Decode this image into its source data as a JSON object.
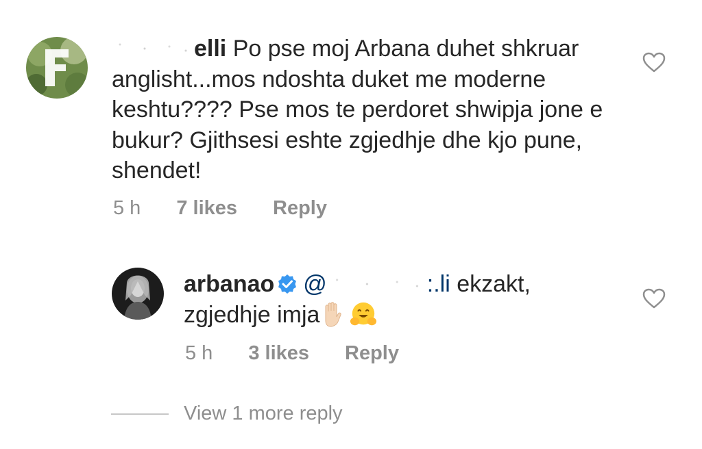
{
  "comments": [
    {
      "username_visible": "elli",
      "text": "Po pse moj Arbana duhet shkruar anglisht...mos ndoshta duket me moderne keshtu???? Pse mos te perdoret shwipja jone e bukur? Gjithsesi eshte zgjedhje dhe kjo pune, shendet!",
      "time": "5 h",
      "likes": "7 likes",
      "reply": "Reply"
    },
    {
      "username": "arbanao",
      "mention_prefix": "@",
      "mention_suffix": ":.li",
      "text_line1": "ekzakt,",
      "text_line2": "zgjedhje imja",
      "time": "5 h",
      "likes": "3 likes",
      "reply": "Reply"
    }
  ],
  "view_more": "View 1 more reply",
  "icons": {
    "like": "heart-outline-icon",
    "verified": "verified-badge-icon"
  },
  "colors": {
    "text": "#262626",
    "meta": "#8e8e8e",
    "verified": "#3897f0"
  }
}
